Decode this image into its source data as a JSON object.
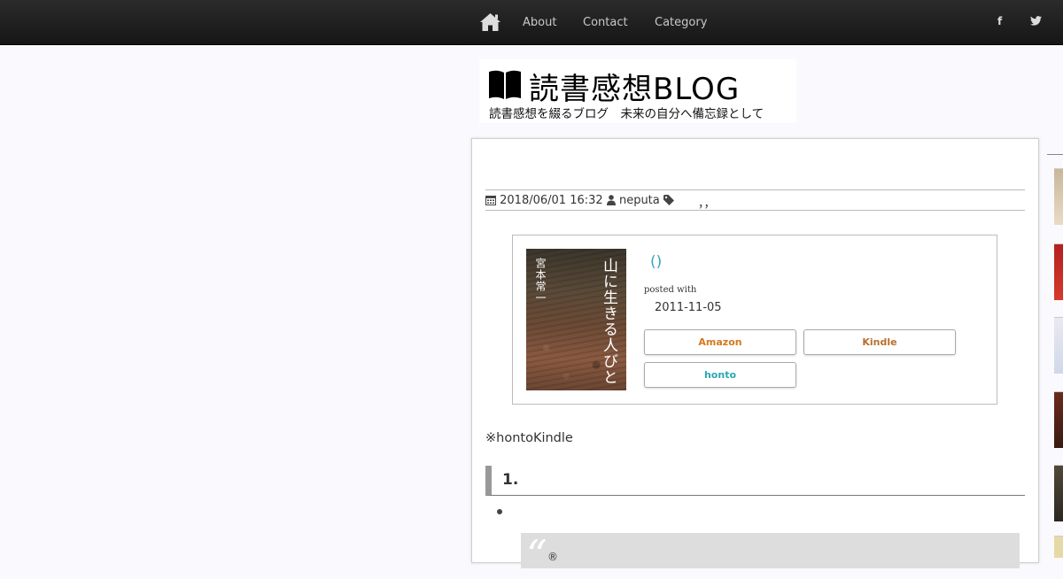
{
  "nav": {
    "home_icon": "home-icon",
    "links": [
      "About",
      "Contact",
      "Category"
    ],
    "social": [
      "f",
      "t"
    ]
  },
  "logo": {
    "title": "読書感想BLOG",
    "subtitle": "読書感想を綴るブログ　未来の自分へ備忘録として"
  },
  "post": {
    "date": "2018/06/01 16:32",
    "author": "neputa",
    "tags": "，，"
  },
  "book": {
    "cover_title": "山に生きる人びと",
    "cover_author": "宮本常一",
    "title_link": "()",
    "posted_with": "posted with",
    "pubdate": "2011-11-05",
    "buttons": {
      "amazon": "Amazon",
      "kindle": "Kindle",
      "honto": "honto"
    }
  },
  "content": {
    "note": "※hontoKindle",
    "heading": "1.",
    "quote_mark": "“",
    "quote_text": "®"
  },
  "colors": {
    "amazon": "#d4791c",
    "kindle": "#b8702c",
    "honto": "#2aa7b3",
    "link": "#3aa0c8"
  }
}
